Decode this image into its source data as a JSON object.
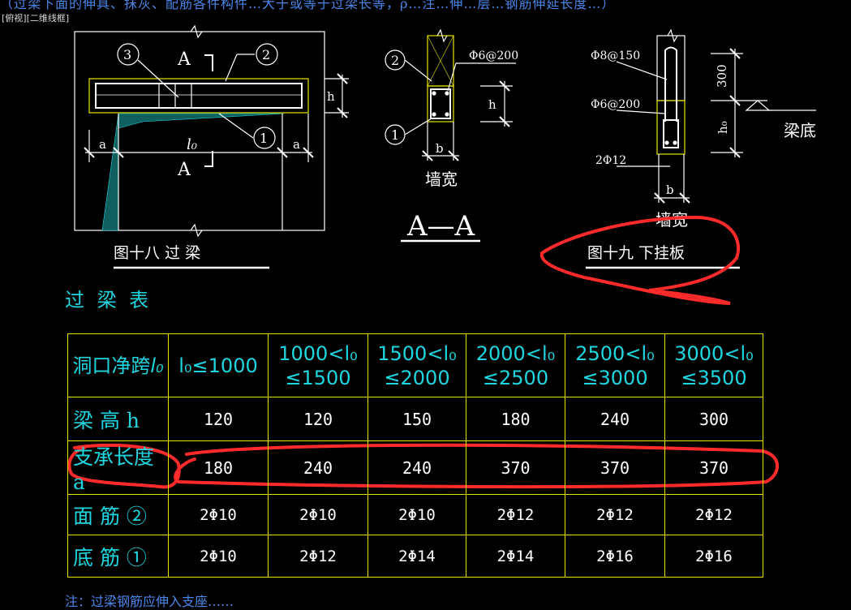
{
  "viewport_label": "[俯视][二维线框]",
  "top_cut_text": "（过梁下面的伸具、抹灰、配筋各件构件…大于或等于过梁长等，ρ…注…伸…层…钢筋伸延长度…）",
  "figure18": {
    "title": "图十八  过  梁",
    "section_mark": "A",
    "callouts": [
      "3",
      "2",
      "1"
    ],
    "dim_h": "h",
    "dim_a_left": "a",
    "dim_a_right": "a",
    "dim_l0": "l₀"
  },
  "section_AA": {
    "title": "A—A",
    "callout_2": "2",
    "callout_1": "1",
    "rebar_label": "Φ6@200",
    "dim_h": "h",
    "dim_b": "b",
    "wall_width": "墙宽"
  },
  "figure19": {
    "title": "图十九   下挂板",
    "rebar_top": "Φ8@150",
    "rebar_mid": "Φ6@200",
    "rebar_bottom": "2Φ12",
    "dim_300": "300",
    "dim_h0": "h₀",
    "beam_bottom": "梁底",
    "dim_b": "b",
    "wall_width": "墙宽"
  },
  "table_title": "过 梁 表",
  "table": {
    "headers": [
      [
        "洞口净跨",
        "l₀"
      ],
      [
        "l₀≤1000",
        ""
      ],
      [
        "1000<l₀",
        "≤1500"
      ],
      [
        "1500<l₀",
        "≤2000"
      ],
      [
        "2000<l₀",
        "≤2500"
      ],
      [
        "2500<l₀",
        "≤3000"
      ],
      [
        "3000<l₀",
        "≤3500"
      ]
    ],
    "rows": [
      {
        "label": "梁 高 h",
        "values": [
          "120",
          "120",
          "150",
          "180",
          "240",
          "300"
        ]
      },
      {
        "label": "支承长度 a",
        "values": [
          "180",
          "240",
          "240",
          "370",
          "370",
          "370"
        ]
      },
      {
        "label": "面 筋 ②",
        "values": [
          "2Φ10",
          "2Φ10",
          "2Φ10",
          "2Φ12",
          "2Φ12",
          "2Φ12"
        ]
      },
      {
        "label": "底 筋 ①",
        "values": [
          "2Φ10",
          "2Φ12",
          "2Φ14",
          "2Φ14",
          "2Φ16",
          "2Φ16"
        ]
      }
    ]
  },
  "bottom_cut_text": "注：过梁钢筋应伸入支座……",
  "colors": {
    "background": "#000000",
    "cad_line": "#ffffff",
    "cyan_text": "#1fd6e0",
    "table_border": "#e6e600",
    "annotation": "#ff2a2a"
  }
}
